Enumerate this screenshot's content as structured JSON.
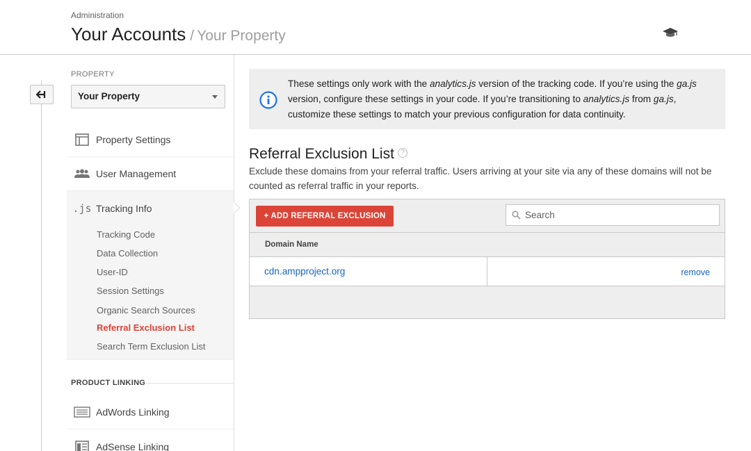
{
  "header": {
    "breadcrumb": "Administration",
    "account": "Your Accounts",
    "separator": "/",
    "property": "Your Property",
    "academy_icon": "graduation-cap-icon"
  },
  "sidebar": {
    "back_icon": "back-arrow-icon",
    "property_label": "PROPERTY",
    "property_selected": "Your Property",
    "items": [
      {
        "label": "Property Settings",
        "icon": "layout-icon"
      },
      {
        "label": "User Management",
        "icon": "users-icon"
      },
      {
        "label": "Tracking Info",
        "icon": "js-icon"
      }
    ],
    "tracking_sub": [
      {
        "label": "Tracking Code"
      },
      {
        "label": "Data Collection"
      },
      {
        "label": "User-ID"
      },
      {
        "label": "Session Settings"
      },
      {
        "label": "Organic Search Sources"
      },
      {
        "label": "Referral Exclusion List",
        "active": true
      },
      {
        "label": "Search Term Exclusion List"
      }
    ],
    "product_linking_label": "PRODUCT LINKING",
    "linking_items": [
      {
        "label": "AdWords Linking",
        "icon": "adwords-icon"
      },
      {
        "label": "AdSense Linking",
        "icon": "adsense-icon"
      }
    ]
  },
  "info_banner": {
    "icon": "info-icon",
    "t1": "These settings only work with the ",
    "e1": "analytics.js",
    "t2": " version of the tracking code. If you’re using the ",
    "e2": "ga.js",
    "t3": " version, configure these settings in your code. If you’re transitioning to ",
    "e3": "analytics.js",
    "t4": " from ",
    "e4": "ga.js",
    "t5": ", customize these settings to match your previous configuration for data continuity."
  },
  "main": {
    "heading": "Referral Exclusion List",
    "help_glyph": "?",
    "description": "Exclude these domains from your referral traffic. Users arriving at your site via any of these domains will not be counted as referral traffic in your reports.",
    "add_button": "+ ADD REFERRAL EXCLUSION",
    "search_placeholder": "Search",
    "column_header": "Domain Name",
    "rows": [
      {
        "domain": "cdn.ampproject.org",
        "action": "remove"
      }
    ]
  },
  "colors": {
    "accent_red": "#db4437",
    "link_blue": "#1565c0",
    "info_blue": "#1a73e8"
  }
}
